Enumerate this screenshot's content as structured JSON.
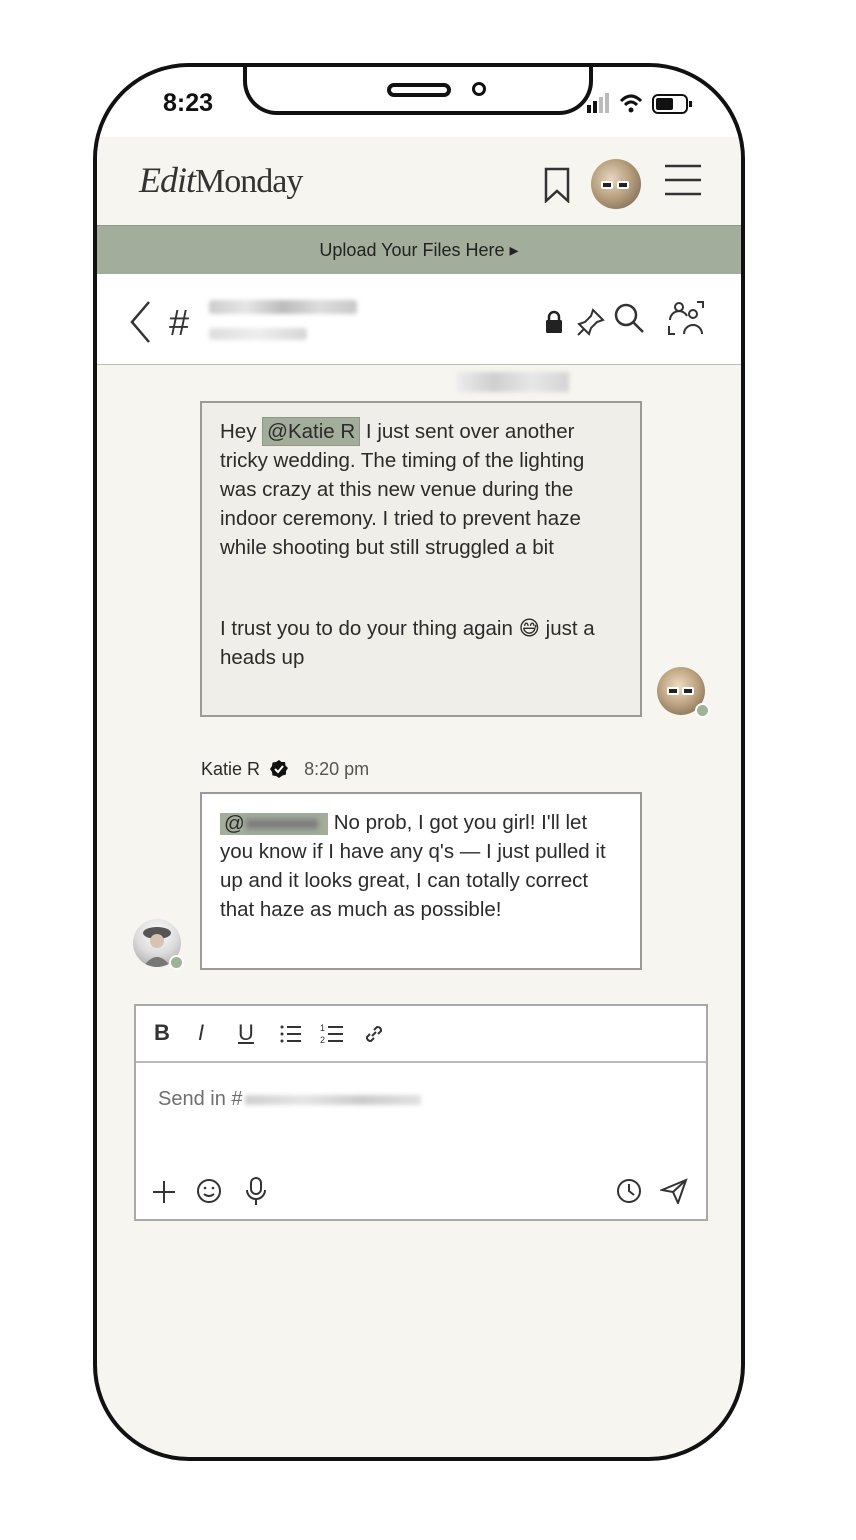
{
  "status_bar": {
    "time": "8:23"
  },
  "header": {
    "logo_script": "Edit",
    "logo_text": "Monday"
  },
  "banner": {
    "text": "Upload Your Files Here ▸"
  },
  "channel": {
    "hash": "#"
  },
  "messages": [
    {
      "author": "",
      "mention": "@Katie R",
      "lines_a": "I just sent over another tricky wedding. The timing of the lighting was crazy at this new venue during the indoor ceremony. I tried to prevent haze while shooting but still struggled a bit",
      "lines_b_before": "I trust you to do your thing again",
      "emoji": "😅",
      "lines_b_after": "just a heads up",
      "greeting": "Hey"
    },
    {
      "author": "Katie R",
      "time": "8:20 pm",
      "mention_prefix": "@",
      "text": "No prob, I got you girl! I'll let you know if I have any q's — I just pulled it up and it looks great, I can totally correct that haze as much as possible!"
    }
  ],
  "composer": {
    "toolbar": {
      "bold": "B",
      "italic": "I",
      "underline": "U"
    },
    "placeholder_prefix": "Send in #"
  },
  "icons": {
    "bookmark": "bookmark-icon",
    "menu": "menu-icon",
    "back": "back-icon",
    "lock": "lock-icon",
    "pin": "pin-icon",
    "search": "search-icon",
    "members": "members-icon",
    "plus": "plus-icon",
    "emoji": "emoji-icon",
    "mic": "mic-icon",
    "schedule": "clock-icon",
    "send": "send-icon"
  },
  "colors": {
    "accent": "#a3ad9b",
    "background": "#f6f5f0"
  }
}
